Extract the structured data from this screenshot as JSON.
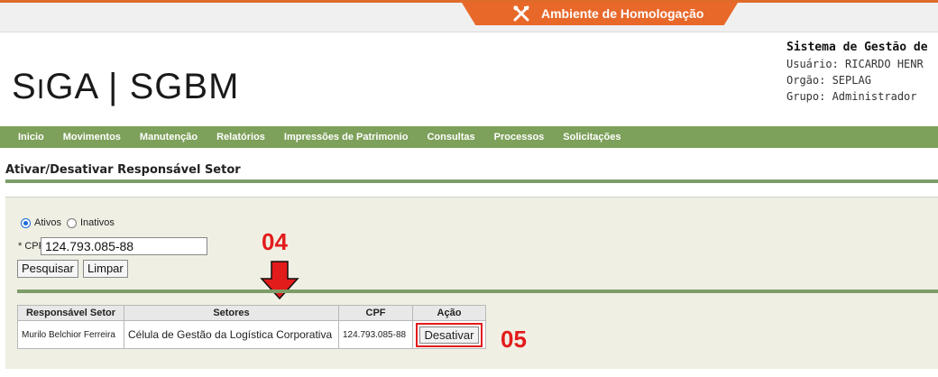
{
  "environment": {
    "label": "Ambiente de Homologação",
    "tab_color": "#e8682a",
    "icon": "tools-icon"
  },
  "header": {
    "logo": "SiGA | SGBM",
    "system_title": "Sistema de Gestão de",
    "user": "Usuário: RICARDO HENR",
    "org": "Orgão: SEPLAG",
    "group": "Grupo: Administrador"
  },
  "nav": {
    "items": [
      "Inicio",
      "Movimentos",
      "Manutenção",
      "Relatórios",
      "Impressões de Patrimonio",
      "Consultas",
      "Processos",
      "Solicitações"
    ],
    "color": "#7da05a"
  },
  "page": {
    "title": "Ativar/Desativar Responsável Setor"
  },
  "filter": {
    "radio_active": "Ativos",
    "radio_inactive": "Inativos",
    "selected": "Ativos",
    "cpf_label": "* CPF:",
    "cpf_value": "124.793.085-88",
    "search_label": "Pesquisar",
    "clear_label": "Limpar"
  },
  "annotations": {
    "step_04": "04",
    "step_05": "05",
    "color": "#e21b1b"
  },
  "table": {
    "headers": [
      "Responsável Setor",
      "Setores",
      "CPF",
      "Ação"
    ],
    "rows": [
      {
        "responsavel": "Murilo Belchior Ferreira",
        "setores": "Célula de Gestão da Logística Corporativa",
        "cpf": "124.793.085-88",
        "acao": "Desativar"
      }
    ]
  }
}
